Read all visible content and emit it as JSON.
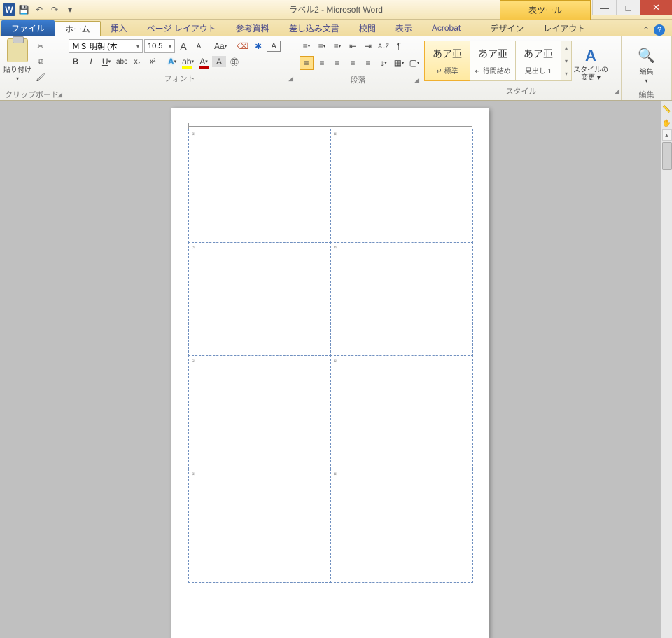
{
  "titlebar": {
    "app_icon": "W",
    "document_title": "ラベル2 - Microsoft Word",
    "table_tools_label": "表ツール",
    "minimize": "—",
    "maximize": "□",
    "close": "✕"
  },
  "qat": {
    "save_tip": "💾",
    "undo_tip": "↶",
    "redo_tip": "↷",
    "customize_tip": "▾"
  },
  "tabs": {
    "file": "ファイル",
    "home": "ホーム",
    "insert": "挿入",
    "page_layout": "ページ レイアウト",
    "references": "参考資料",
    "mailings": "差し込み文書",
    "review": "校閲",
    "view": "表示",
    "acrobat": "Acrobat",
    "design": "デザイン",
    "layout": "レイアウト",
    "min_ribbon": "⌃",
    "help": "?"
  },
  "ribbon": {
    "clipboard": {
      "paste": "貼り付け",
      "label": "クリップボード"
    },
    "font": {
      "name": "ＭＳ 明朝 (本",
      "size": "10.5",
      "label": "フォント",
      "grow": "A",
      "shrink": "A",
      "case": "Aa",
      "clear": "⌫",
      "phonetic": "✱",
      "charborder": "A",
      "bold": "B",
      "italic": "I",
      "underline": "U",
      "strike": "abc",
      "sub": "x₂",
      "sup": "x²",
      "texteffect": "A",
      "highlight": "ab",
      "fontcolor": "A",
      "charshade": "A",
      "enclose": "㊞"
    },
    "paragraph": {
      "label": "段落",
      "bullets": "≡",
      "numbering": "≡",
      "multilevel": "≡",
      "dec_indent": "⇤",
      "inc_indent": "⇥",
      "ltr": "¶",
      "align_left": "≡",
      "align_center": "≡",
      "align_right": "≡",
      "justify": "≡",
      "distribute": "≡",
      "linespace": "↕",
      "shading": "▦",
      "borders": "▢",
      "sort": "A↓Z",
      "marks": "¶"
    },
    "styles": {
      "label": "スタイル",
      "preview": "あア亜",
      "item1": "↵ 標準",
      "item2": "↵ 行間詰め",
      "item3": "見出し 1",
      "change": "スタイルの\n変更 ▾"
    },
    "editing": {
      "label": "編集",
      "find": "編集"
    }
  },
  "document": {
    "cell_mark": "¤"
  }
}
